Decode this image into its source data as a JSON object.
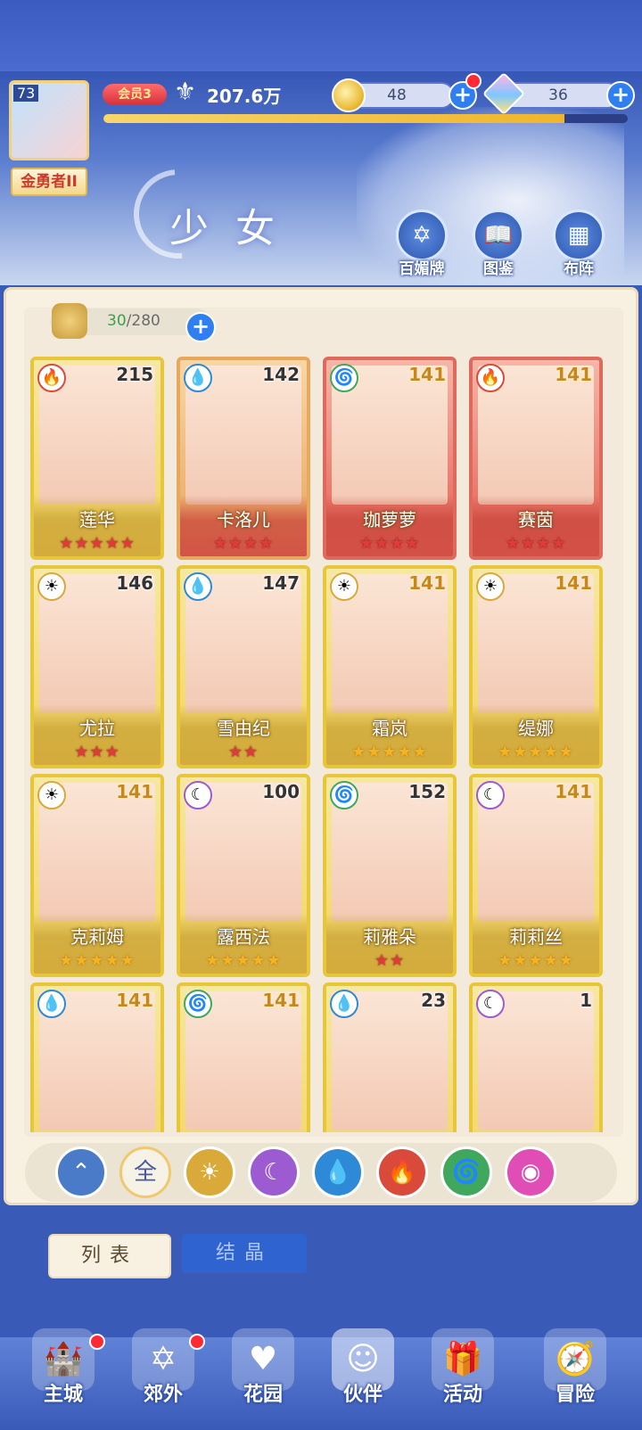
{
  "player": {
    "level": "73",
    "title": "金勇者II",
    "vip": "会员3",
    "power": "207.6万",
    "exp_fraction": 0.88
  },
  "resources": {
    "coins": "48",
    "gems": "36",
    "plus": "+"
  },
  "page": {
    "title": "少女",
    "buttons": [
      {
        "label": "百媚牌",
        "icon": "card-icon"
      },
      {
        "label": "图鉴",
        "icon": "book-icon"
      },
      {
        "label": "布阵",
        "icon": "grid-icon"
      }
    ]
  },
  "bag": {
    "current": "30",
    "separator": "/",
    "max": "280",
    "plus": "+"
  },
  "cards": [
    {
      "name": "莲华",
      "level": "215",
      "element": "fire",
      "stars": 5,
      "star_color": "red",
      "frame": "gold"
    },
    {
      "name": "卡洛儿",
      "level": "142",
      "element": "water",
      "stars": 4,
      "star_color": "red",
      "frame": "orange"
    },
    {
      "name": "珈萝萝",
      "level": "141",
      "element": "wind",
      "stars": 4,
      "star_color": "red",
      "frame": "red"
    },
    {
      "name": "赛茵",
      "level": "141",
      "element": "fire",
      "stars": 4,
      "star_color": "red",
      "frame": "red"
    },
    {
      "name": "尤拉",
      "level": "146",
      "element": "light",
      "stars": 3,
      "star_color": "red",
      "frame": "gold"
    },
    {
      "name": "雪由纪",
      "level": "147",
      "element": "water",
      "stars": 2,
      "star_color": "red",
      "frame": "gold"
    },
    {
      "name": "霜岚",
      "level": "141",
      "element": "light",
      "stars": 5,
      "star_color": "gold",
      "frame": "gold"
    },
    {
      "name": "缇娜",
      "level": "141",
      "element": "light",
      "stars": 5,
      "star_color": "gold",
      "frame": "gold"
    },
    {
      "name": "克莉姆",
      "level": "141",
      "element": "light",
      "stars": 5,
      "star_color": "gold",
      "frame": "gold"
    },
    {
      "name": "露西法",
      "level": "100",
      "element": "dark",
      "stars": 5,
      "star_color": "gold",
      "frame": "gold"
    },
    {
      "name": "莉雅朵",
      "level": "152",
      "element": "wind",
      "stars": 2,
      "star_color": "red",
      "frame": "gold"
    },
    {
      "name": "莉莉丝",
      "level": "141",
      "element": "dark",
      "stars": 5,
      "star_color": "gold",
      "frame": "gold"
    },
    {
      "name": "",
      "level": "141",
      "element": "water",
      "stars": 0,
      "star_color": "gold",
      "frame": "gold"
    },
    {
      "name": "",
      "level": "141",
      "element": "wind",
      "stars": 0,
      "star_color": "gold",
      "frame": "gold"
    },
    {
      "name": "",
      "level": "23",
      "element": "water",
      "stars": 0,
      "star_color": "gold",
      "frame": "gold"
    },
    {
      "name": "",
      "level": "1",
      "element": "dark",
      "stars": 0,
      "star_color": "gold",
      "frame": "gold"
    }
  ],
  "filters": [
    {
      "id": "collapse",
      "label": "",
      "color": "#4a7bc8"
    },
    {
      "id": "all",
      "label": "全",
      "color": "#f7f2e6"
    },
    {
      "id": "light",
      "label": "",
      "color": "#d9a93a"
    },
    {
      "id": "dark",
      "label": "",
      "color": "#9d5bd1"
    },
    {
      "id": "water",
      "label": "",
      "color": "#2e8ad6"
    },
    {
      "id": "fire",
      "label": "",
      "color": "#d94a3a"
    },
    {
      "id": "wind",
      "label": "",
      "color": "#3fa85c"
    },
    {
      "id": "special",
      "label": "",
      "color": "#e04db5"
    }
  ],
  "tabs": {
    "list": "列表",
    "crystal": "结晶"
  },
  "nav": [
    {
      "label": "主城",
      "icon": "castle-icon",
      "badge": true
    },
    {
      "label": "郊外",
      "icon": "portal-icon",
      "badge": true
    },
    {
      "label": "花园",
      "icon": "heart-icon",
      "badge": false
    },
    {
      "label": "伙伴",
      "icon": "partner-icon",
      "badge": false,
      "active": true
    },
    {
      "label": "活动",
      "icon": "gift-icon",
      "badge": false
    },
    {
      "label": "冒险",
      "icon": "compass-icon",
      "badge": false
    }
  ]
}
